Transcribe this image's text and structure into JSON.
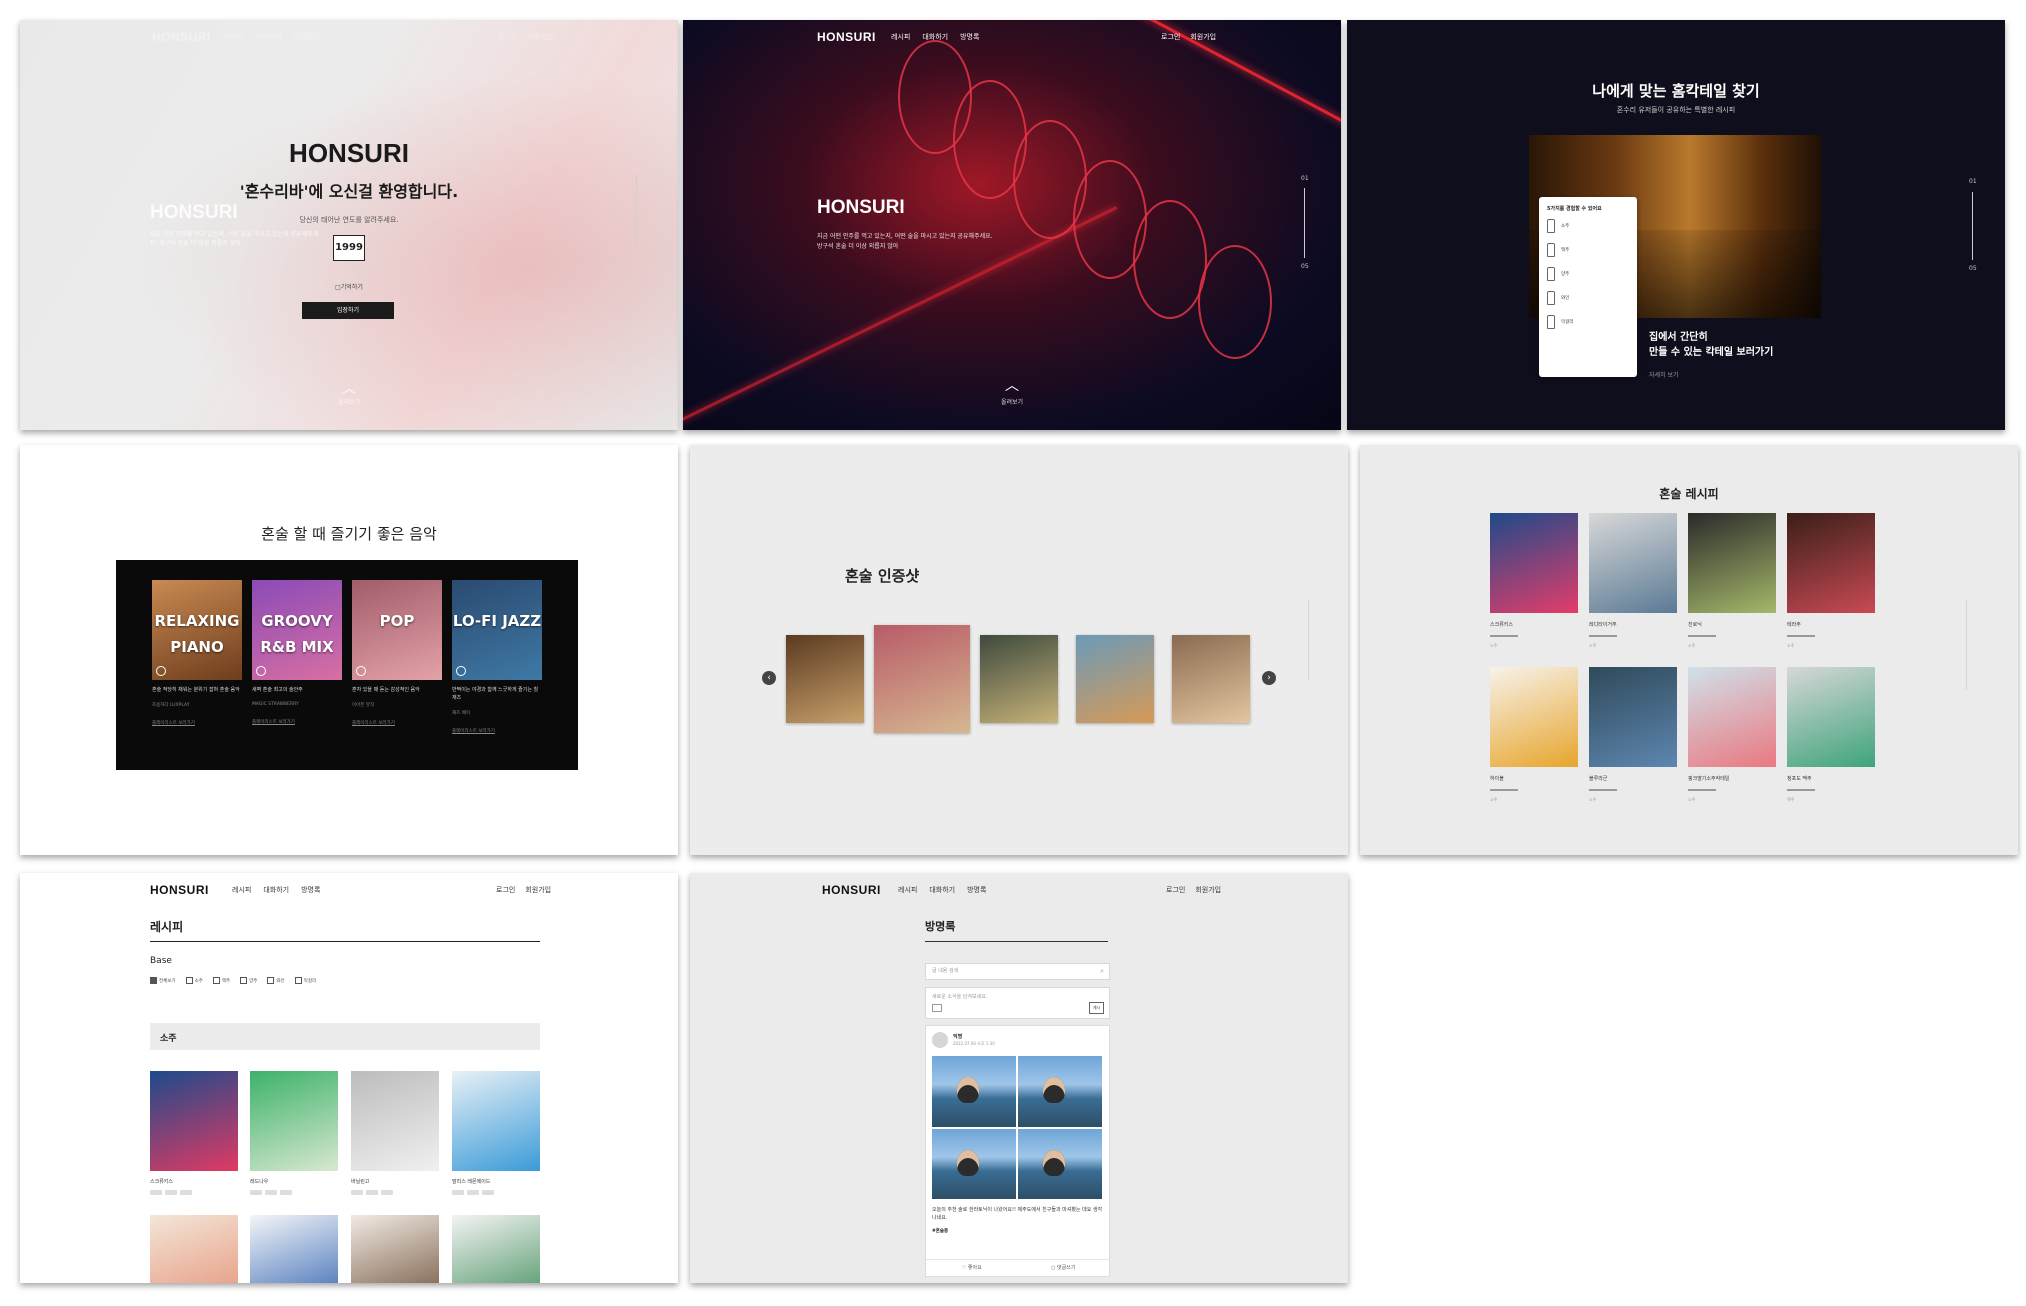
{
  "brand": "HONSURI",
  "nav": {
    "links": [
      "레시피",
      "대화하기",
      "방명록"
    ],
    "login": "로그인",
    "signup": "회원가입"
  },
  "intro": {
    "title": "HONSURI",
    "welcome": "'혼수리바'에 오신걸 환영합니다.",
    "ask_birth": "당신의 태어난 연도를 알려주세요.",
    "year_value": "1999",
    "remember": "기억하기",
    "enter_button": "입장하기",
    "ghost_title": "HONSURI",
    "ghost_text": "지금 어떤 안주를 먹고 있는지, 어떤 술을 마시고 있는지 공유해주세요. 방구석 혼술 더 이상 외롭지 않아",
    "scroll_label": "올려보기"
  },
  "hero": {
    "title": "HONSURI",
    "text_line1": "지금 어떤 안주를 먹고 있는지, 어떤 술을 마시고 있는지 공유해주세요.",
    "text_line2": "방구석 혼술 더 이상 외롭지 않아",
    "pager_top": "01",
    "pager_bottom": "05",
    "scroll_label": "올려보기"
  },
  "cocktail_find": {
    "title": "나에게 맞는 홈칵테일 찾기",
    "subtitle": "혼수리 유저들이 공유하는 특별한 레시피",
    "card_title": "5가지를 경험할 수 있어요",
    "card_rows": [
      "소주",
      "맥주",
      "양주",
      "와인",
      "막걸리"
    ],
    "caption_line1": "집에서 간단히",
    "caption_line2": "만들 수 있는 칵테일 보러가기",
    "more": "자세히 보기",
    "pager_top": "01",
    "pager_bottom": "05"
  },
  "music": {
    "title": "혼술 할 때 즐기기 좋은 음악",
    "cards": [
      {
        "label": "RELAXING PIANO",
        "desc": "혼술 적당히 채워는 분위기 잡혀 혼술 음악",
        "sub": "조용하다 LUXPLAY",
        "link": "플레이리스트 보러가기",
        "colors": [
          "#c98a52",
          "#6e3d1d"
        ]
      },
      {
        "label": "GROOVY R&B MIX",
        "desc": "새벽 혼술 최고의 술안주",
        "sub": "MAGIC STRAWBERRY",
        "link": "플레이리스트 보러가기",
        "colors": [
          "#8a4bb8",
          "#d86fa2"
        ]
      },
      {
        "label": "POP",
        "desc": "혼자 있을 때 듣는 감성적인 음악",
        "sub": "이어폰 뮤직",
        "link": "플레이리스트 보러가기",
        "colors": [
          "#a25c6a",
          "#e3a2a8"
        ]
      },
      {
        "label": "LO-FI JAZZ",
        "desc": "반짝이는 야경과 함께 느긋하게 즐기는 힐 재즈",
        "sub": "재즈 베이",
        "link": "플레이리스트 보러가기",
        "colors": [
          "#2b4a70",
          "#3e79a6"
        ]
      }
    ]
  },
  "shots": {
    "title": "혼술 인증샷",
    "photos": [
      {
        "colors": [
          "#5a3a21",
          "#c9a06b"
        ]
      },
      {
        "colors": [
          "#b85b68",
          "#d6b790"
        ]
      },
      {
        "colors": [
          "#3d4a3d",
          "#c7b27a"
        ]
      },
      {
        "colors": [
          "#6b9ab8",
          "#d79a56"
        ]
      },
      {
        "colors": [
          "#8a6a50",
          "#e3c6a0"
        ]
      }
    ]
  },
  "recipes": {
    "title": "혼술 레시피",
    "items": [
      {
        "name": "스크류키스",
        "meta": "소주",
        "colors": [
          "#1e4a8a",
          "#e33d6a"
        ]
      },
      {
        "name": "레디타이거주",
        "meta": "소주",
        "colors": [
          "#d8d8d8",
          "#5b7a95"
        ]
      },
      {
        "name": "진로닉",
        "meta": "소주",
        "colors": [
          "#2a2a2a",
          "#a5b86a"
        ]
      },
      {
        "name": "테라주",
        "meta": "소주",
        "colors": [
          "#3a1f18",
          "#c94a55"
        ]
      },
      {
        "name": "하이볼",
        "meta": "소주",
        "colors": [
          "#f7f2ea",
          "#e7a52c"
        ]
      },
      {
        "name": "블루라군",
        "meta": "소주",
        "colors": [
          "#2f4a5a",
          "#5d86b0"
        ]
      },
      {
        "name": "핑크딸기소주칵테일",
        "meta": "소주",
        "colors": [
          "#cfe1ea",
          "#ea7880"
        ]
      },
      {
        "name": "청포도 맥주",
        "meta": "맥주",
        "colors": [
          "#d7d7d7",
          "#3ea47b"
        ]
      }
    ]
  },
  "recipe_page": {
    "title": "레시피",
    "base_label": "Base",
    "filters": [
      "전체보기",
      "소주",
      "맥주",
      "양주",
      "와인",
      "막걸리"
    ],
    "section": "소주",
    "items": [
      {
        "name": "스크류키스",
        "colors": [
          "#1d4a8c",
          "#e03a63"
        ]
      },
      {
        "name": "레드나우",
        "colors": [
          "#3cb26a",
          "#d8e8d0"
        ]
      },
      {
        "name": "바닐린고",
        "colors": [
          "#bcbcbc",
          "#f0f0f0"
        ]
      },
      {
        "name": "말리스 레몬에이드",
        "colors": [
          "#e8f0f6",
          "#3a9bd8"
        ]
      },
      {
        "name": "",
        "colors": [
          "#f3e6d8",
          "#e58f74"
        ]
      },
      {
        "name": "",
        "colors": [
          "#f4f6f8",
          "#2c5fb0"
        ]
      },
      {
        "name": "",
        "colors": [
          "#f1ebe4",
          "#6a4a32"
        ]
      },
      {
        "name": "",
        "colors": [
          "#f4f4f4",
          "#3b8a55"
        ]
      }
    ]
  },
  "guestbook": {
    "title": "방명록",
    "search_placeholder": "글 내용 검색",
    "post_placeholder": "새로운 소식을 남겨보세요.",
    "post_button": "게시",
    "user": "익명",
    "date": "2022.07.04 오후 1:30",
    "body": "오늘의 추천 술로 한라토닉이 나왔어요!! 제주도에서 친구들과 마셔봤는 데요 생각나네요.",
    "tag": "#혼술중",
    "like": "좋아요",
    "comment": "댓글쓰기"
  }
}
